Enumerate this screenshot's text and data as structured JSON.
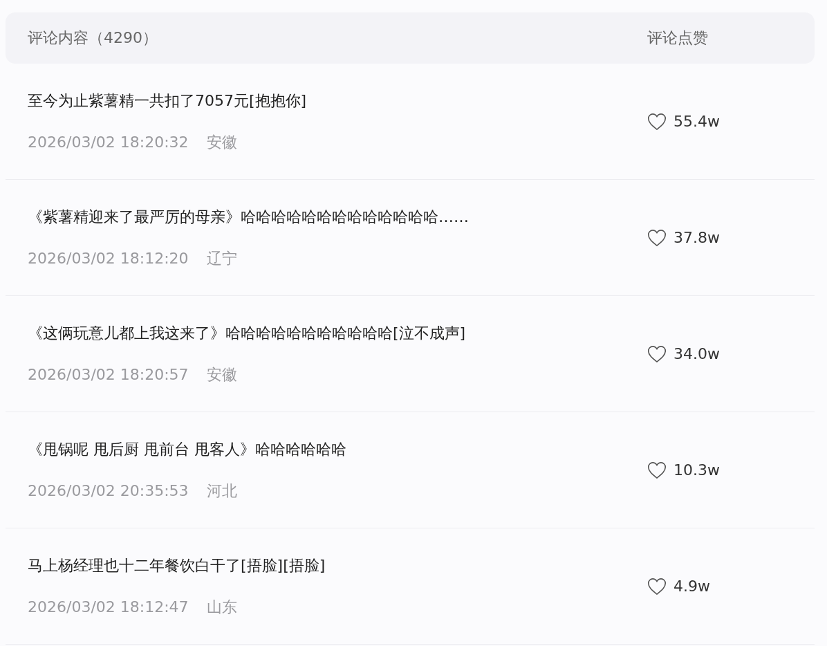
{
  "header": {
    "content_label": "评论内容（4290）",
    "likes_label": "评论点赞"
  },
  "comments": [
    {
      "text": "至今为止紫薯精一共扣了7057元[抱抱你]",
      "time": "2026/03/02 18:20:32",
      "region": "安徽",
      "likes": "55.4w"
    },
    {
      "text": "《紫薯精迎来了最严厉的母亲》哈哈哈哈哈哈哈哈哈哈哈哈哈……",
      "time": "2026/03/02 18:12:20",
      "region": "辽宁",
      "likes": "37.8w"
    },
    {
      "text": "《这俩玩意儿都上我这来了》哈哈哈哈哈哈哈哈哈哈哈[泣不成声]",
      "time": "2026/03/02 18:20:57",
      "region": "安徽",
      "likes": "34.0w"
    },
    {
      "text": "《甩锅呢 甩后厨 甩前台 甩客人》哈哈哈哈哈哈",
      "time": "2026/03/02 20:35:53",
      "region": "河北",
      "likes": "10.3w"
    },
    {
      "text": "马上杨经理也十二年餐饮白干了[捂脸][捂脸]",
      "time": "2026/03/02 18:12:47",
      "region": "山东",
      "likes": "4.9w"
    }
  ]
}
